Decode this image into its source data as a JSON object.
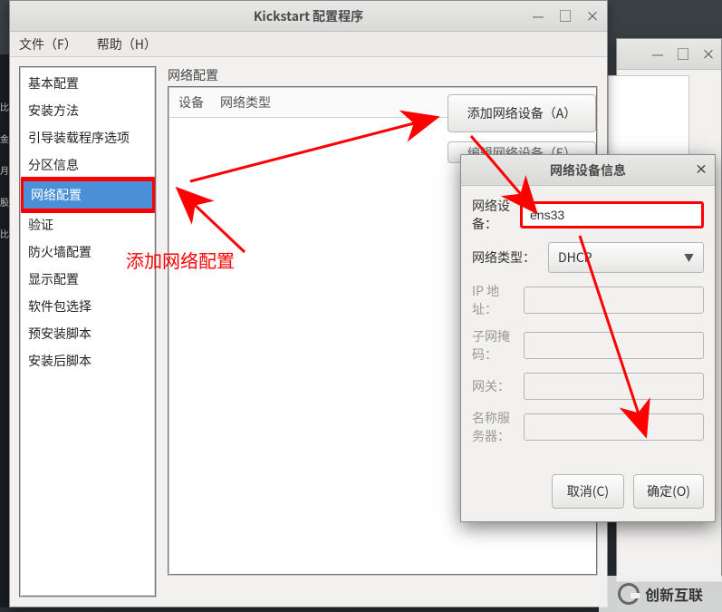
{
  "window": {
    "title": "Kickstart 配置程序",
    "menu": {
      "file": "文件（F）",
      "help": "帮助（H）"
    }
  },
  "sidebar": {
    "items": [
      {
        "label": "基本配置"
      },
      {
        "label": "安装方法"
      },
      {
        "label": "引导装载程序选项"
      },
      {
        "label": "分区信息"
      },
      {
        "label": "网络配置",
        "selected": true
      },
      {
        "label": "验证"
      },
      {
        "label": "防火墙配置"
      },
      {
        "label": "显示配置"
      },
      {
        "label": "软件包选择"
      },
      {
        "label": "预安装脚本"
      },
      {
        "label": "安装后脚本"
      }
    ]
  },
  "content": {
    "panel_title": "网络配置",
    "table_headers": {
      "device": "设备",
      "net_type": "网络类型"
    },
    "buttons": {
      "add": "添加网络设备（A）",
      "edit": "编辑网络设备（E）"
    }
  },
  "dialog": {
    "title": "网络设备信息",
    "fields": {
      "device_label": "网络设备：",
      "device_value": "ens33",
      "type_label": "网络类型：",
      "type_value": "DHCP",
      "ip_label": "IP 地址：",
      "netmask_label": "子网掩码：",
      "gateway_label": "网关：",
      "nameserver_label": "名称服务器："
    },
    "buttons": {
      "cancel": "取消(C)",
      "ok": "确定(O)"
    }
  },
  "annotation": {
    "text": "添加网络配置"
  },
  "watermark": {
    "text": "创新互联"
  }
}
